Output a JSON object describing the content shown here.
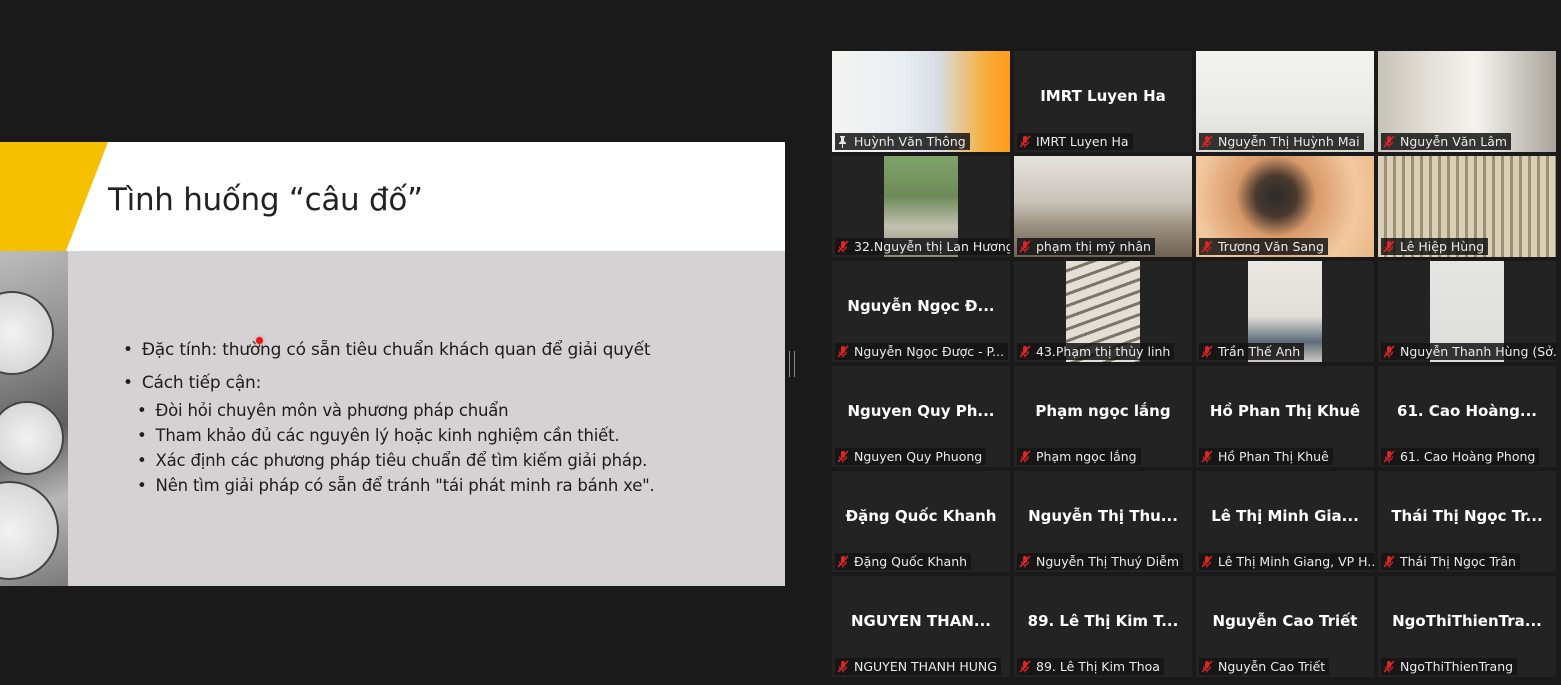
{
  "slide": {
    "title": "Tình huống “câu đố”",
    "bullets": [
      {
        "text": "Đặc tính: thường có sẵn tiêu chuẩn khách quan để giải quyết",
        "sub": []
      },
      {
        "text": "Cách tiếp cận:",
        "sub": [
          "Đòi hỏi chuyên môn và phương pháp chuẩn",
          "Tham khảo đủ các nguyên lý hoặc kinh nghiệm cần thiết.",
          "Xác định các phương pháp tiêu chuẩn để tìm kiếm giải pháp.",
          "Nên tìm giải pháp có sẵn để tránh \"tái phát minh ra bánh xe\"."
        ]
      }
    ],
    "colors": {
      "accent": "#f5c000",
      "body_bg": "#d4d2d3"
    }
  },
  "gallery": {
    "active_speaker_color": "#d9e600",
    "muted_icon_color": "#e02424",
    "tiles": [
      {
        "label": "Huỳnh Văn Thông",
        "bigname": "",
        "video": "speaker",
        "icon": "pin-icon",
        "active": true
      },
      {
        "label": "IMRT Luyen Ha",
        "bigname": "IMRT Luyen Ha",
        "video": "",
        "icon": "mic-muted-icon",
        "active": false
      },
      {
        "label": "Nguyễn Thị Huỳnh Mai",
        "bigname": "",
        "video": "room-light",
        "icon": "mic-muted-icon",
        "active": false
      },
      {
        "label": "Nguyễn Văn Lâm",
        "bigname": "",
        "video": "shelf",
        "icon": "mic-muted-icon",
        "active": false
      },
      {
        "label": "32.Nguyễn thị Lan Hương",
        "bigname": "",
        "video": "window-green",
        "icon": "mic-muted-icon",
        "active": false
      },
      {
        "label": "phạm thị mỹ nhân",
        "bigname": "",
        "video": "desk-books",
        "icon": "mic-muted-icon",
        "active": false
      },
      {
        "label": "Trương Văn Sang",
        "bigname": "",
        "video": "orange-face",
        "icon": "mic-muted-icon",
        "active": false
      },
      {
        "label": "Lê Hiệp Hùng",
        "bigname": "",
        "video": "blinds",
        "icon": "mic-muted-icon",
        "active": false
      },
      {
        "label": "Nguyễn Ngọc Được - P...",
        "bigname": "Nguyễn Ngọc Đ...",
        "video": "",
        "icon": "mic-muted-icon",
        "active": false
      },
      {
        "label": "43.Phạm thị thùy linh",
        "bigname": "",
        "video": "window-bars",
        "icon": "mic-muted-icon",
        "active": false
      },
      {
        "label": "Trần Thế Anh",
        "bigname": "",
        "video": "wall-shelf",
        "icon": "mic-muted-icon",
        "active": false
      },
      {
        "label": "Nguyễn Thanh Hùng (Sở...",
        "bigname": "",
        "video": "plain-wall",
        "icon": "mic-muted-icon",
        "active": false
      },
      {
        "label": "Nguyen Quy Phuong",
        "bigname": "Nguyen Quy Ph...",
        "video": "",
        "icon": "mic-muted-icon",
        "active": false
      },
      {
        "label": "Phạm ngọc lắng",
        "bigname": "Phạm ngọc lắng",
        "video": "",
        "icon": "mic-muted-icon",
        "active": false
      },
      {
        "label": "Hồ Phan Thị Khuê",
        "bigname": "Hồ Phan Thị Khuê",
        "video": "",
        "icon": "mic-muted-icon",
        "active": false
      },
      {
        "label": "61. Cao Hoàng Phong",
        "bigname": "61. Cao Hoàng...",
        "video": "",
        "icon": "mic-muted-icon",
        "active": false
      },
      {
        "label": "Đặng Quốc Khanh",
        "bigname": "Đặng Quốc Khanh",
        "video": "",
        "icon": "mic-muted-icon",
        "active": false
      },
      {
        "label": "Nguyễn Thị Thuý Diễm",
        "bigname": "Nguyễn Thị Thu...",
        "video": "",
        "icon": "mic-muted-icon",
        "active": false
      },
      {
        "label": "Lê Thị Minh Giang, VP H...",
        "bigname": "Lê Thị Minh Gia...",
        "video": "",
        "icon": "mic-muted-icon",
        "active": false
      },
      {
        "label": "Thái Thị Ngọc Trân",
        "bigname": "Thái Thị Ngọc Tr...",
        "video": "",
        "icon": "mic-muted-icon",
        "active": false
      },
      {
        "label": "NGUYEN THANH HUNG",
        "bigname": "NGUYEN THAN...",
        "video": "",
        "icon": "mic-muted-icon",
        "active": false
      },
      {
        "label": "89. Lê Thị Kim Thoa",
        "bigname": "89. Lê Thị Kim T...",
        "video": "",
        "icon": "mic-muted-icon",
        "active": false
      },
      {
        "label": "Nguyễn Cao Triết",
        "bigname": "Nguyễn Cao Triết",
        "video": "",
        "icon": "mic-muted-icon",
        "active": false
      },
      {
        "label": "NgoThiThienTrang",
        "bigname": "NgoThiThienTra...",
        "video": "",
        "icon": "mic-muted-icon",
        "active": false
      }
    ]
  }
}
